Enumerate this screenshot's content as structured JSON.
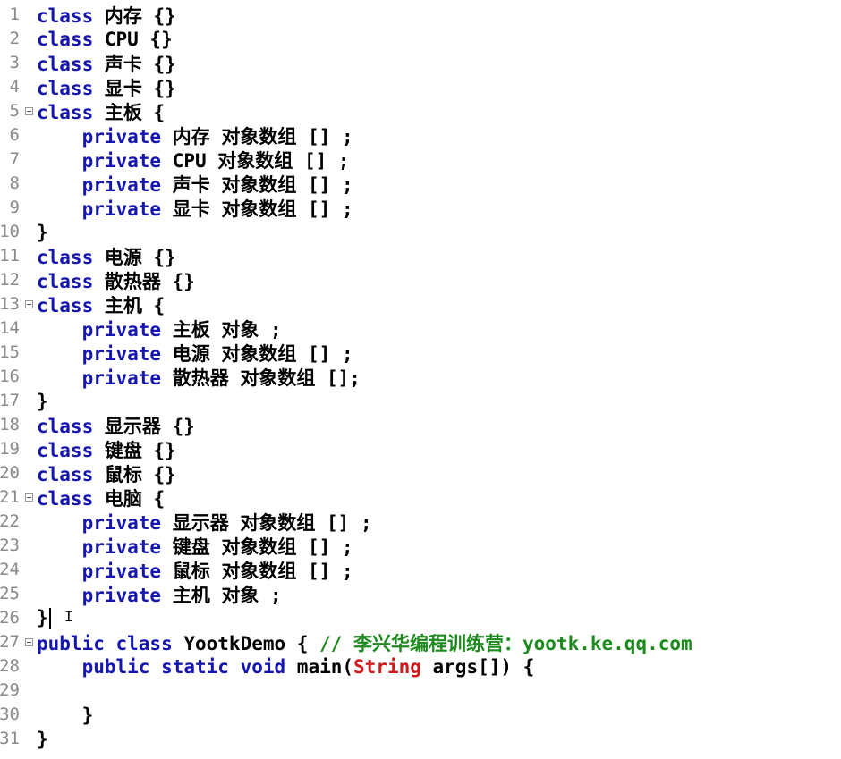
{
  "editor": {
    "colors": {
      "keyword": "#1515b0",
      "type": "#d01b1b",
      "comment": "#1d8a1d",
      "text": "#000000",
      "gutter": "#8a8a8a"
    },
    "lines": [
      {
        "n": "1",
        "fold": false,
        "tokens": [
          {
            "t": "class",
            "c": "kw"
          },
          {
            "t": " 内存 {}",
            "c": ""
          }
        ]
      },
      {
        "n": "2",
        "fold": false,
        "tokens": [
          {
            "t": "class",
            "c": "kw"
          },
          {
            "t": " CPU {}",
            "c": ""
          }
        ]
      },
      {
        "n": "3",
        "fold": false,
        "tokens": [
          {
            "t": "class",
            "c": "kw"
          },
          {
            "t": " 声卡 {}",
            "c": ""
          }
        ]
      },
      {
        "n": "4",
        "fold": false,
        "tokens": [
          {
            "t": "class",
            "c": "kw"
          },
          {
            "t": " 显卡 {}",
            "c": ""
          }
        ]
      },
      {
        "n": "5",
        "fold": true,
        "tokens": [
          {
            "t": "class",
            "c": "kw"
          },
          {
            "t": " 主板 {",
            "c": ""
          }
        ]
      },
      {
        "n": "6",
        "fold": false,
        "tokens": [
          {
            "t": "    ",
            "c": ""
          },
          {
            "t": "private",
            "c": "kw"
          },
          {
            "t": " 内存 对象数组 [] ;",
            "c": ""
          }
        ]
      },
      {
        "n": "7",
        "fold": false,
        "tokens": [
          {
            "t": "    ",
            "c": ""
          },
          {
            "t": "private",
            "c": "kw"
          },
          {
            "t": " CPU 对象数组 [] ;",
            "c": ""
          }
        ]
      },
      {
        "n": "8",
        "fold": false,
        "tokens": [
          {
            "t": "    ",
            "c": ""
          },
          {
            "t": "private",
            "c": "kw"
          },
          {
            "t": " 声卡 对象数组 [] ;",
            "c": ""
          }
        ]
      },
      {
        "n": "9",
        "fold": false,
        "tokens": [
          {
            "t": "    ",
            "c": ""
          },
          {
            "t": "private",
            "c": "kw"
          },
          {
            "t": " 显卡 对象数组 [] ;",
            "c": ""
          }
        ]
      },
      {
        "n": "10",
        "fold": false,
        "tokens": [
          {
            "t": "}",
            "c": ""
          }
        ]
      },
      {
        "n": "11",
        "fold": false,
        "tokens": [
          {
            "t": "class",
            "c": "kw"
          },
          {
            "t": " 电源 {}",
            "c": ""
          }
        ]
      },
      {
        "n": "12",
        "fold": false,
        "tokens": [
          {
            "t": "class",
            "c": "kw"
          },
          {
            "t": " 散热器 {}",
            "c": ""
          }
        ]
      },
      {
        "n": "13",
        "fold": true,
        "tokens": [
          {
            "t": "class",
            "c": "kw"
          },
          {
            "t": " 主机 {",
            "c": ""
          }
        ]
      },
      {
        "n": "14",
        "fold": false,
        "tokens": [
          {
            "t": "    ",
            "c": ""
          },
          {
            "t": "private",
            "c": "kw"
          },
          {
            "t": " 主板 对象 ;",
            "c": ""
          }
        ]
      },
      {
        "n": "15",
        "fold": false,
        "tokens": [
          {
            "t": "    ",
            "c": ""
          },
          {
            "t": "private",
            "c": "kw"
          },
          {
            "t": " 电源 对象数组 [] ;",
            "c": ""
          }
        ]
      },
      {
        "n": "16",
        "fold": false,
        "tokens": [
          {
            "t": "    ",
            "c": ""
          },
          {
            "t": "private",
            "c": "kw"
          },
          {
            "t": " 散热器 对象数组 [];",
            "c": ""
          }
        ]
      },
      {
        "n": "17",
        "fold": false,
        "tokens": [
          {
            "t": "}",
            "c": ""
          }
        ]
      },
      {
        "n": "18",
        "fold": false,
        "tokens": [
          {
            "t": "class",
            "c": "kw"
          },
          {
            "t": " 显示器 {}",
            "c": ""
          }
        ]
      },
      {
        "n": "19",
        "fold": false,
        "tokens": [
          {
            "t": "class",
            "c": "kw"
          },
          {
            "t": " 键盘 {}",
            "c": ""
          }
        ]
      },
      {
        "n": "20",
        "fold": false,
        "tokens": [
          {
            "t": "class",
            "c": "kw"
          },
          {
            "t": " 鼠标 {}",
            "c": ""
          }
        ]
      },
      {
        "n": "21",
        "fold": true,
        "tokens": [
          {
            "t": "class",
            "c": "kw"
          },
          {
            "t": " 电脑 {",
            "c": ""
          }
        ]
      },
      {
        "n": "22",
        "fold": false,
        "tokens": [
          {
            "t": "    ",
            "c": ""
          },
          {
            "t": "private",
            "c": "kw"
          },
          {
            "t": " 显示器 对象数组 [] ;",
            "c": ""
          }
        ]
      },
      {
        "n": "23",
        "fold": false,
        "tokens": [
          {
            "t": "    ",
            "c": ""
          },
          {
            "t": "private",
            "c": "kw"
          },
          {
            "t": " 键盘 对象数组 [] ;",
            "c": ""
          }
        ]
      },
      {
        "n": "24",
        "fold": false,
        "tokens": [
          {
            "t": "    ",
            "c": ""
          },
          {
            "t": "private",
            "c": "kw"
          },
          {
            "t": " 鼠标 对象数组 [] ;",
            "c": ""
          }
        ]
      },
      {
        "n": "25",
        "fold": false,
        "tokens": [
          {
            "t": "    ",
            "c": ""
          },
          {
            "t": "private",
            "c": "kw"
          },
          {
            "t": " 主机 对象 ;",
            "c": ""
          }
        ]
      },
      {
        "n": "26",
        "fold": false,
        "caret": true,
        "tokens": [
          {
            "t": "}",
            "c": ""
          }
        ]
      },
      {
        "n": "27",
        "fold": true,
        "tokens": [
          {
            "t": "public class",
            "c": "kw"
          },
          {
            "t": " YootkDemo { ",
            "c": ""
          },
          {
            "t": "// 李兴华编程训练营：yootk.ke.qq.com",
            "c": "cmt"
          }
        ]
      },
      {
        "n": "28",
        "fold": false,
        "tokens": [
          {
            "t": "    ",
            "c": ""
          },
          {
            "t": "public static void",
            "c": "kw"
          },
          {
            "t": " main(",
            "c": ""
          },
          {
            "t": "String",
            "c": "str"
          },
          {
            "t": " args[]) {",
            "c": ""
          }
        ]
      },
      {
        "n": "29",
        "fold": false,
        "tokens": []
      },
      {
        "n": "30",
        "fold": false,
        "tokens": [
          {
            "t": "    }",
            "c": ""
          }
        ]
      },
      {
        "n": "31",
        "fold": false,
        "tokens": [
          {
            "t": "}",
            "c": ""
          }
        ]
      }
    ]
  }
}
